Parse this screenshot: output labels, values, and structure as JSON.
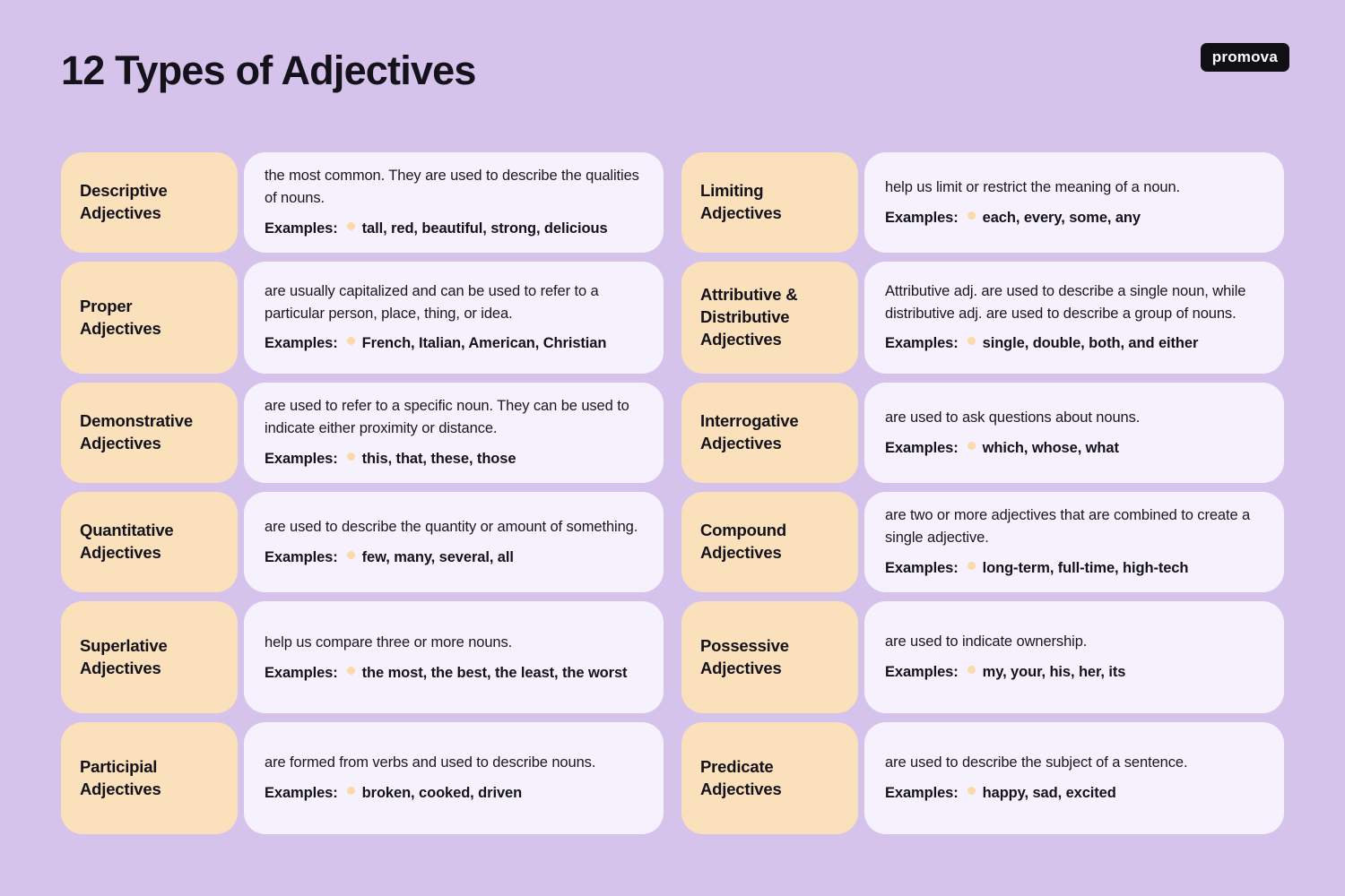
{
  "header": {
    "title": "12 Types of Adjectives",
    "logo": "promova"
  },
  "labels": {
    "examples": "Examples:"
  },
  "colors": {
    "background": "#d6c3ec",
    "label_card": "#fbe0bc",
    "body_card": "#f6f2fd",
    "bullet": "#fbd9a8",
    "text": "#14121a",
    "logo_background": "#100f14",
    "logo_text": "#ffffff"
  },
  "cards": [
    {
      "title": "Descriptive\nAdjectives",
      "description": "the most common. They are used to describe the qualities of nouns.",
      "examples": "tall, red, beautiful, strong, delicious"
    },
    {
      "title": "Limiting\nAdjectives",
      "description": "help us limit or restrict the meaning of a noun.",
      "examples": "each, every, some, any"
    },
    {
      "title": "Proper\nAdjectives",
      "description": "are usually capitalized and can be used to refer to a particular person, place, thing, or idea.",
      "examples": "French, Italian, American, Christian"
    },
    {
      "title": "Attributive &\nDistributive\nAdjectives",
      "description": "Attributive adj. are used to describe a single noun, while distributive adj. are used to describe a group of nouns.",
      "examples": "single, double, both, and either"
    },
    {
      "title": "Demonstrative\nAdjectives",
      "description": "are used to refer to a specific noun. They can be used to indicate either proximity or distance.",
      "examples": "this, that, these, those"
    },
    {
      "title": "Interrogative\nAdjectives",
      "description": "are used to ask questions about nouns.",
      "examples": "which, whose, what"
    },
    {
      "title": "Quantitative\nAdjectives",
      "description": "are used to describe the quantity or amount of something.",
      "examples": "few, many, several, all"
    },
    {
      "title": "Compound\nAdjectives",
      "description": "are two or more adjectives that are combined to create a single adjective.",
      "examples": "long-term, full-time, high-tech"
    },
    {
      "title": "Superlative\nAdjectives",
      "description": "help us compare three or more nouns.",
      "examples": "the most, the best, the least, the worst"
    },
    {
      "title": "Possessive\nAdjectives",
      "description": "are used to indicate ownership.",
      "examples": "my, your, his, her, its"
    },
    {
      "title": "Participial\nAdjectives",
      "description": "are formed from verbs and used to describe nouns.",
      "examples": "broken, cooked, driven"
    },
    {
      "title": "Predicate\nAdjectives",
      "description": "are used to describe the subject of a sentence.",
      "examples": "happy, sad, excited"
    }
  ]
}
